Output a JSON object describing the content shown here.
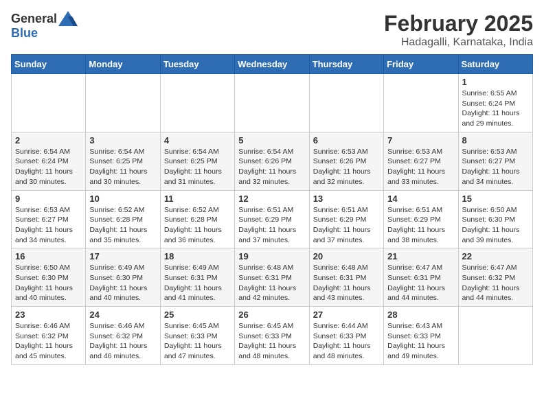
{
  "logo": {
    "general": "General",
    "blue": "Blue"
  },
  "title": "February 2025",
  "location": "Hadagalli, Karnataka, India",
  "headers": [
    "Sunday",
    "Monday",
    "Tuesday",
    "Wednesday",
    "Thursday",
    "Friday",
    "Saturday"
  ],
  "weeks": [
    [
      {
        "day": "",
        "info": ""
      },
      {
        "day": "",
        "info": ""
      },
      {
        "day": "",
        "info": ""
      },
      {
        "day": "",
        "info": ""
      },
      {
        "day": "",
        "info": ""
      },
      {
        "day": "",
        "info": ""
      },
      {
        "day": "1",
        "info": "Sunrise: 6:55 AM\nSunset: 6:24 PM\nDaylight: 11 hours\nand 29 minutes."
      }
    ],
    [
      {
        "day": "2",
        "info": "Sunrise: 6:54 AM\nSunset: 6:24 PM\nDaylight: 11 hours\nand 30 minutes."
      },
      {
        "day": "3",
        "info": "Sunrise: 6:54 AM\nSunset: 6:25 PM\nDaylight: 11 hours\nand 30 minutes."
      },
      {
        "day": "4",
        "info": "Sunrise: 6:54 AM\nSunset: 6:25 PM\nDaylight: 11 hours\nand 31 minutes."
      },
      {
        "day": "5",
        "info": "Sunrise: 6:54 AM\nSunset: 6:26 PM\nDaylight: 11 hours\nand 32 minutes."
      },
      {
        "day": "6",
        "info": "Sunrise: 6:53 AM\nSunset: 6:26 PM\nDaylight: 11 hours\nand 32 minutes."
      },
      {
        "day": "7",
        "info": "Sunrise: 6:53 AM\nSunset: 6:27 PM\nDaylight: 11 hours\nand 33 minutes."
      },
      {
        "day": "8",
        "info": "Sunrise: 6:53 AM\nSunset: 6:27 PM\nDaylight: 11 hours\nand 34 minutes."
      }
    ],
    [
      {
        "day": "9",
        "info": "Sunrise: 6:53 AM\nSunset: 6:27 PM\nDaylight: 11 hours\nand 34 minutes."
      },
      {
        "day": "10",
        "info": "Sunrise: 6:52 AM\nSunset: 6:28 PM\nDaylight: 11 hours\nand 35 minutes."
      },
      {
        "day": "11",
        "info": "Sunrise: 6:52 AM\nSunset: 6:28 PM\nDaylight: 11 hours\nand 36 minutes."
      },
      {
        "day": "12",
        "info": "Sunrise: 6:51 AM\nSunset: 6:29 PM\nDaylight: 11 hours\nand 37 minutes."
      },
      {
        "day": "13",
        "info": "Sunrise: 6:51 AM\nSunset: 6:29 PM\nDaylight: 11 hours\nand 37 minutes."
      },
      {
        "day": "14",
        "info": "Sunrise: 6:51 AM\nSunset: 6:29 PM\nDaylight: 11 hours\nand 38 minutes."
      },
      {
        "day": "15",
        "info": "Sunrise: 6:50 AM\nSunset: 6:30 PM\nDaylight: 11 hours\nand 39 minutes."
      }
    ],
    [
      {
        "day": "16",
        "info": "Sunrise: 6:50 AM\nSunset: 6:30 PM\nDaylight: 11 hours\nand 40 minutes."
      },
      {
        "day": "17",
        "info": "Sunrise: 6:49 AM\nSunset: 6:30 PM\nDaylight: 11 hours\nand 40 minutes."
      },
      {
        "day": "18",
        "info": "Sunrise: 6:49 AM\nSunset: 6:31 PM\nDaylight: 11 hours\nand 41 minutes."
      },
      {
        "day": "19",
        "info": "Sunrise: 6:48 AM\nSunset: 6:31 PM\nDaylight: 11 hours\nand 42 minutes."
      },
      {
        "day": "20",
        "info": "Sunrise: 6:48 AM\nSunset: 6:31 PM\nDaylight: 11 hours\nand 43 minutes."
      },
      {
        "day": "21",
        "info": "Sunrise: 6:47 AM\nSunset: 6:31 PM\nDaylight: 11 hours\nand 44 minutes."
      },
      {
        "day": "22",
        "info": "Sunrise: 6:47 AM\nSunset: 6:32 PM\nDaylight: 11 hours\nand 44 minutes."
      }
    ],
    [
      {
        "day": "23",
        "info": "Sunrise: 6:46 AM\nSunset: 6:32 PM\nDaylight: 11 hours\nand 45 minutes."
      },
      {
        "day": "24",
        "info": "Sunrise: 6:46 AM\nSunset: 6:32 PM\nDaylight: 11 hours\nand 46 minutes."
      },
      {
        "day": "25",
        "info": "Sunrise: 6:45 AM\nSunset: 6:33 PM\nDaylight: 11 hours\nand 47 minutes."
      },
      {
        "day": "26",
        "info": "Sunrise: 6:45 AM\nSunset: 6:33 PM\nDaylight: 11 hours\nand 48 minutes."
      },
      {
        "day": "27",
        "info": "Sunrise: 6:44 AM\nSunset: 6:33 PM\nDaylight: 11 hours\nand 48 minutes."
      },
      {
        "day": "28",
        "info": "Sunrise: 6:43 AM\nSunset: 6:33 PM\nDaylight: 11 hours\nand 49 minutes."
      },
      {
        "day": "",
        "info": ""
      }
    ]
  ]
}
